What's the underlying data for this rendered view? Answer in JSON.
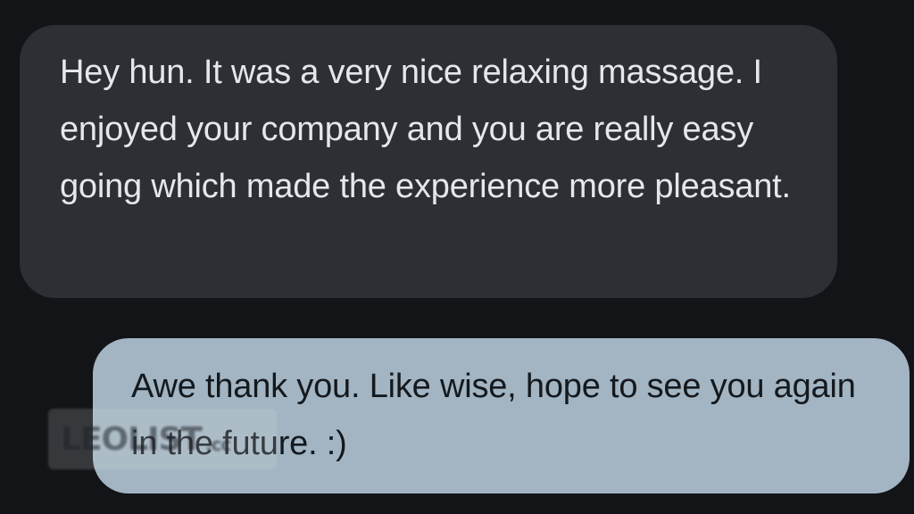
{
  "messages": [
    {
      "direction": "incoming",
      "text": "Hey hun. It was a very nice relaxing massage. I enjoyed your company and you are really easy going which made the experience more pleasant."
    },
    {
      "direction": "outgoing",
      "text": "Awe thank you. Like wise, hope to see you again in the future. :)"
    }
  ],
  "watermark": {
    "text": "LEOLIST",
    "suffix": ".cc"
  },
  "colors": {
    "background": "#121418",
    "incoming_bubble": "#2d2f34",
    "incoming_text": "#e6e7ea",
    "outgoing_bubble": "#a3b5c3",
    "outgoing_text": "#14191e"
  }
}
